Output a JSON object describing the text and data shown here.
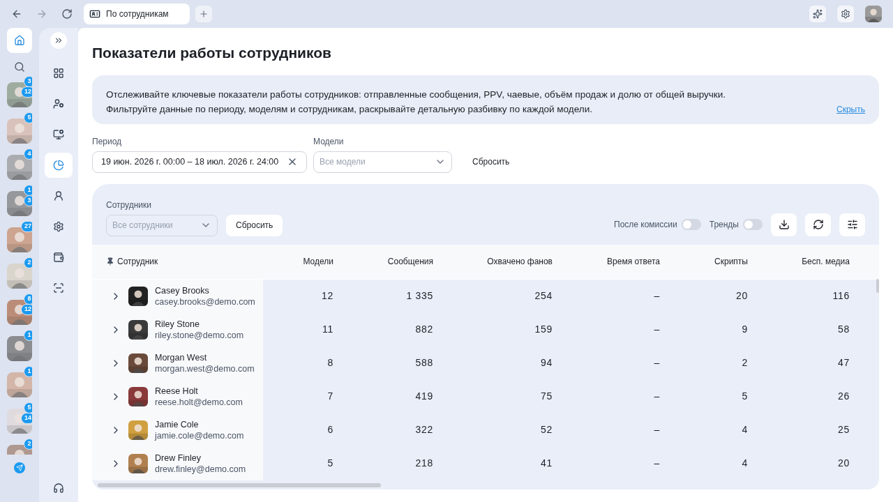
{
  "browser": {
    "tabs": [
      {
        "title": "По сотрудникам",
        "selected": true
      }
    ]
  },
  "rail": {
    "home_selected": true,
    "chats": [
      {
        "badges": [
          "3",
          "12"
        ]
      },
      {
        "badges": [
          "5"
        ]
      },
      {
        "badges": [
          "4"
        ]
      },
      {
        "badges": [
          "1",
          "3"
        ]
      },
      {
        "badges": [
          "27"
        ]
      },
      {
        "badges": [
          "2"
        ]
      },
      {
        "badges": [
          "8",
          "12"
        ]
      },
      {
        "badges": [
          "1"
        ]
      },
      {
        "badges": [
          "1"
        ]
      },
      {
        "badges": [
          "5",
          "14"
        ]
      },
      {
        "badges": [
          "2"
        ]
      }
    ]
  },
  "nav": [
    {
      "selected": false
    },
    {
      "selected": false
    },
    {
      "selected": false
    },
    {
      "selected": true
    },
    {
      "selected": false
    },
    {
      "selected": false
    },
    {
      "selected": false
    },
    {
      "selected": false
    }
  ],
  "page": {
    "title": "Показатели работы сотрудников",
    "info": {
      "lines": [
        "Отслеживайте ключевые показатели работы сотрудников: отправленные сообщения, PPV, чаевые, объём продаж и долю от общей выручки.",
        "Фильтруйте данные по периоду, моделям и сотрудникам, раскрывайте детальную разбивку по каждой модели."
      ],
      "hide_link": "Скрыть"
    },
    "filters": {
      "period_label": "Период",
      "period_value": "19 июн. 2026 г. 00:00 – 18 июл. 2026 г. 24:00",
      "models_label": "Модели",
      "models_placeholder": "Все модели",
      "reset": "Сбросить"
    },
    "table_card": {
      "employees_label": "Сотрудники",
      "employees_placeholder": "Все сотрудники",
      "reset": "Сбросить",
      "toggles": [
        {
          "label": "После комиссии",
          "on": false
        },
        {
          "label": "Тренды",
          "on": false
        }
      ],
      "employee_column": "Сотрудник",
      "columns": [
        "Модели",
        "Сообщения",
        "Охвачено фанов",
        "Время ответа",
        "Скрипты",
        "Бесп. медиа"
      ],
      "rows": [
        {
          "name": "Casey Brooks",
          "email": "casey.brooks@demo.com",
          "expanded": false,
          "cells": [
            "12",
            "1 335",
            "254",
            "–",
            "20",
            "116"
          ]
        },
        {
          "name": "Riley Stone",
          "email": "riley.stone@demo.com",
          "expanded": false,
          "cells": [
            "11",
            "882",
            "159",
            "–",
            "9",
            "58"
          ]
        },
        {
          "name": "Morgan West",
          "email": "morgan.west@demo.com",
          "expanded": false,
          "cells": [
            "8",
            "588",
            "94",
            "–",
            "2",
            "47"
          ]
        },
        {
          "name": "Reese Holt",
          "email": "reese.holt@demo.com",
          "expanded": false,
          "cells": [
            "7",
            "419",
            "75",
            "–",
            "5",
            "26"
          ]
        },
        {
          "name": "Jamie Cole",
          "email": "jamie.cole@demo.com",
          "expanded": false,
          "cells": [
            "6",
            "322",
            "52",
            "–",
            "4",
            "25"
          ]
        },
        {
          "name": "Drew Finley",
          "email": "drew.finley@demo.com",
          "expanded": false,
          "cells": [
            "5",
            "218",
            "41",
            "–",
            "4",
            "20"
          ]
        }
      ]
    }
  }
}
